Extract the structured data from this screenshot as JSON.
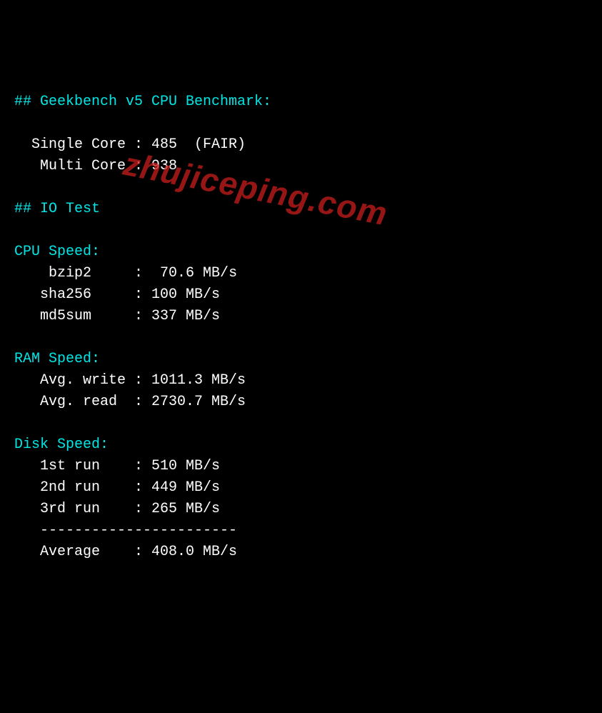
{
  "headers": {
    "geekbench": "## Geekbench v5 CPU Benchmark:",
    "io_test": "## IO Test"
  },
  "geekbench": {
    "single_core_label": "  Single Core : ",
    "single_core_value": "485  (FAIR)",
    "multi_core_label": "   Multi Core : ",
    "multi_core_value": "938"
  },
  "cpu_speed": {
    "header": "CPU Speed:",
    "bzip2_label": "    bzip2     :  ",
    "bzip2_value": "70.6 MB/s",
    "sha256_label": "   sha256     : ",
    "sha256_value": "100 MB/s",
    "md5sum_label": "   md5sum     : ",
    "md5sum_value": "337 MB/s"
  },
  "ram_speed": {
    "header": "RAM Speed:",
    "write_label": "   Avg. write : ",
    "write_value": "1011.3 MB/s",
    "read_label": "   Avg. read  : ",
    "read_value": "2730.7 MB/s"
  },
  "disk_speed": {
    "header": "Disk Speed:",
    "run1_label": "   1st run    : ",
    "run1_value": "510 MB/s",
    "run2_label": "   2nd run    : ",
    "run2_value": "449 MB/s",
    "run3_label": "   3rd run    : ",
    "run3_value": "265 MB/s",
    "divider": "   -----------------------",
    "avg_label": "   Average    : ",
    "avg_value": "408.0 MB/s"
  },
  "watermark": "zhujiceping.com"
}
